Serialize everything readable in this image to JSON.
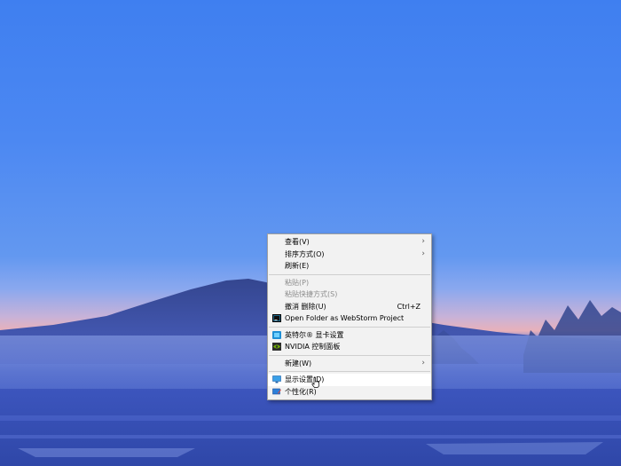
{
  "context_menu": {
    "items": [
      {
        "label": "查看(V)",
        "submenu": true
      },
      {
        "label": "排序方式(O)",
        "submenu": true
      },
      {
        "label": "刷新(E)"
      },
      {
        "label": "粘贴(P)",
        "disabled": true
      },
      {
        "label": "粘贴快捷方式(S)",
        "disabled": true
      },
      {
        "label": "撤消 删除(U)",
        "shortcut": "Ctrl+Z"
      },
      {
        "label": "Open Folder as WebStorm Project",
        "icon": "webstorm-icon"
      },
      {
        "label": "英特尔® 显卡设置",
        "icon": "intel-graphics-icon"
      },
      {
        "label": "NVIDIA 控制面板",
        "icon": "nvidia-icon"
      },
      {
        "label": "新建(W)",
        "submenu": true
      },
      {
        "label": "显示设置(D)",
        "icon": "display-settings-icon",
        "hovered": true
      },
      {
        "label": "个性化(R)",
        "icon": "personalize-icon"
      }
    ],
    "arrow_glyph": "›"
  },
  "colors": {
    "menu_bg": "#f2f2f2",
    "menu_hover": "#ffffff",
    "disabled_text": "#8d8d8d",
    "sky_top": "#3f7ff0",
    "horizon_pink": "#e9b1b9"
  }
}
